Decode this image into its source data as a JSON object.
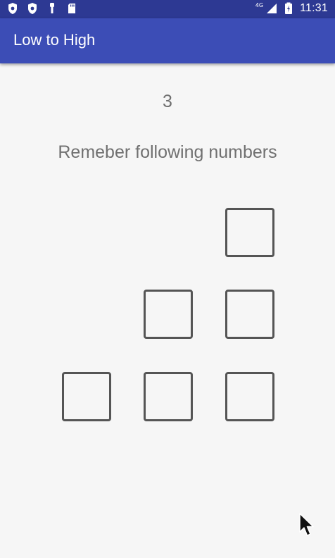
{
  "status_bar": {
    "network_type": "4G",
    "time": "11:31",
    "left_icons": [
      "shield-icon",
      "shield-icon",
      "usb-icon",
      "sd-card-icon"
    ],
    "right_icons": [
      "signal-icon",
      "battery-icon"
    ]
  },
  "app_bar": {
    "title": "Low to High",
    "color": "#3c4db6",
    "status_color": "#2d3993"
  },
  "main": {
    "counter": "3",
    "instruction": "Remeber following numbers",
    "cells": [
      {
        "row": 1,
        "col": 3,
        "value": ""
      },
      {
        "row": 2,
        "col": 2,
        "value": ""
      },
      {
        "row": 2,
        "col": 3,
        "value": ""
      },
      {
        "row": 3,
        "col": 1,
        "value": ""
      },
      {
        "row": 3,
        "col": 2,
        "value": ""
      },
      {
        "row": 3,
        "col": 3,
        "value": ""
      }
    ]
  }
}
